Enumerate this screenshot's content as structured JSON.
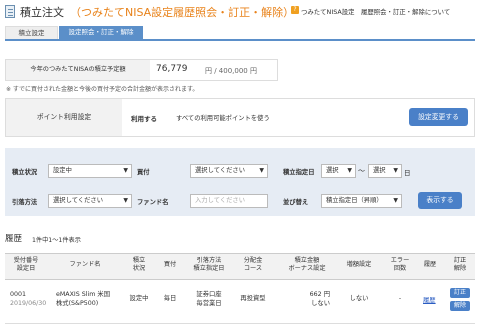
{
  "title": {
    "main": "積立注文",
    "sub": "（つみたてNISA設定履歴照会・訂正・解除）",
    "help_link": "つみたてNISA設定　履歴照会・訂正・解除について"
  },
  "tabs": [
    {
      "label": "積立設定"
    },
    {
      "label": "設定照会・訂正・解除"
    }
  ],
  "plan": {
    "label": "今年のつみたてNISAの積立予定額",
    "value": "76,779",
    "total": "円 / 400,000 円",
    "note": "※ すでに買付された金額と今後の買付予定の合計金額が表示されます。"
  },
  "points": {
    "label": "ポイント利用設定",
    "status": "利用する",
    "detail": "すべての利用可能ポイントを使う",
    "button": "設定変更する"
  },
  "filter": {
    "status_label": "積立状況",
    "status_value": "設定中",
    "buy_label": "買付",
    "buy_value": "選択してください",
    "date_label": "積立指定日",
    "date_from": "選択",
    "date_to": "選択",
    "day_unit": "日",
    "tilde": "〜",
    "method_label": "引落方法",
    "method_value": "選択してください",
    "fund_label": "ファンド名",
    "fund_placeholder": "入力してください",
    "sort_label": "並び替え",
    "sort_value": "積立指定日（昇順）",
    "show_button": "表示する"
  },
  "history": {
    "title": "履歴",
    "count": "1件中1〜1件表示",
    "columns": [
      {
        "l1": "受付番号",
        "l2": "設定日"
      },
      {
        "l1": "ファンド名",
        "l2": ""
      },
      {
        "l1": "積立",
        "l2": "状況"
      },
      {
        "l1": "買付",
        "l2": ""
      },
      {
        "l1": "引落方法",
        "l2": "積立指定日"
      },
      {
        "l1": "分配金",
        "l2": "コース"
      },
      {
        "l1": "積立金額",
        "l2": "ボーナス設定"
      },
      {
        "l1": "増額設定",
        "l2": ""
      },
      {
        "l1": "エラー",
        "l2": "回数"
      },
      {
        "l1": "履歴",
        "l2": ""
      },
      {
        "l1": "訂正",
        "l2": "解除"
      }
    ],
    "rows": [
      {
        "id": "0001",
        "date": "2019/06/30",
        "fund1": "eMAXIS Slim 米国",
        "fund2": "株式(S&P500)",
        "status": "設定中",
        "buy": "毎日",
        "method1": "証券口座",
        "method2": "毎営業日",
        "course": "再投資型",
        "amount": "662 円",
        "bonus": "しない",
        "increase": "しない",
        "errors": "-",
        "history_link": "履歴",
        "edit": "訂正",
        "cancel": "解除"
      }
    ]
  }
}
